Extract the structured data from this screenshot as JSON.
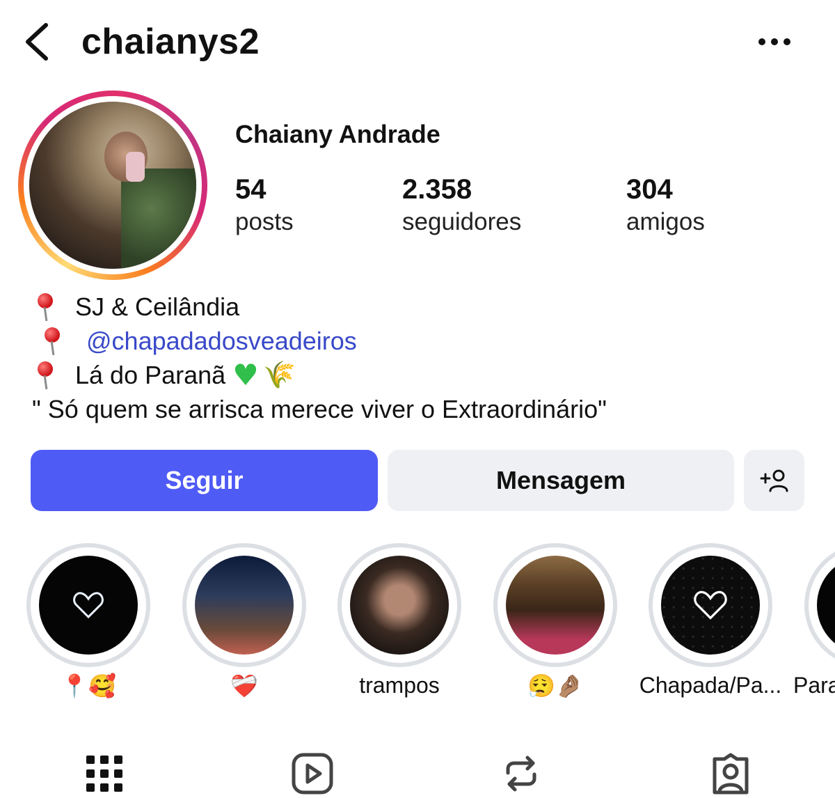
{
  "header": {
    "username": "chaianys2"
  },
  "profile": {
    "display_name": "Chaiany Andrade",
    "stats": [
      {
        "value": "54",
        "label": "posts"
      },
      {
        "value": "2.358",
        "label": "seguidores"
      },
      {
        "value": "304",
        "label": "amigos"
      }
    ],
    "bio": {
      "line1": "SJ & Ceilândia",
      "line2": "@chapadadosveadeiros",
      "line3": "Lá do Paranã",
      "line4": "\" Só quem se arrisca merece viver o Extraordinário\""
    }
  },
  "actions": {
    "follow_label": "Seguir",
    "message_label": "Mensagem"
  },
  "highlights": [
    {
      "label": "📍🥰"
    },
    {
      "label": "❤️‍🩹"
    },
    {
      "label": "trampos"
    },
    {
      "label": "😮‍💨🤌🏽"
    },
    {
      "label": "Chapada/Pa..."
    },
    {
      "label": "Para"
    }
  ],
  "colors": {
    "accent": "#4f5bf5",
    "link": "#3949c9",
    "secondary_button": "#eef0f3"
  }
}
